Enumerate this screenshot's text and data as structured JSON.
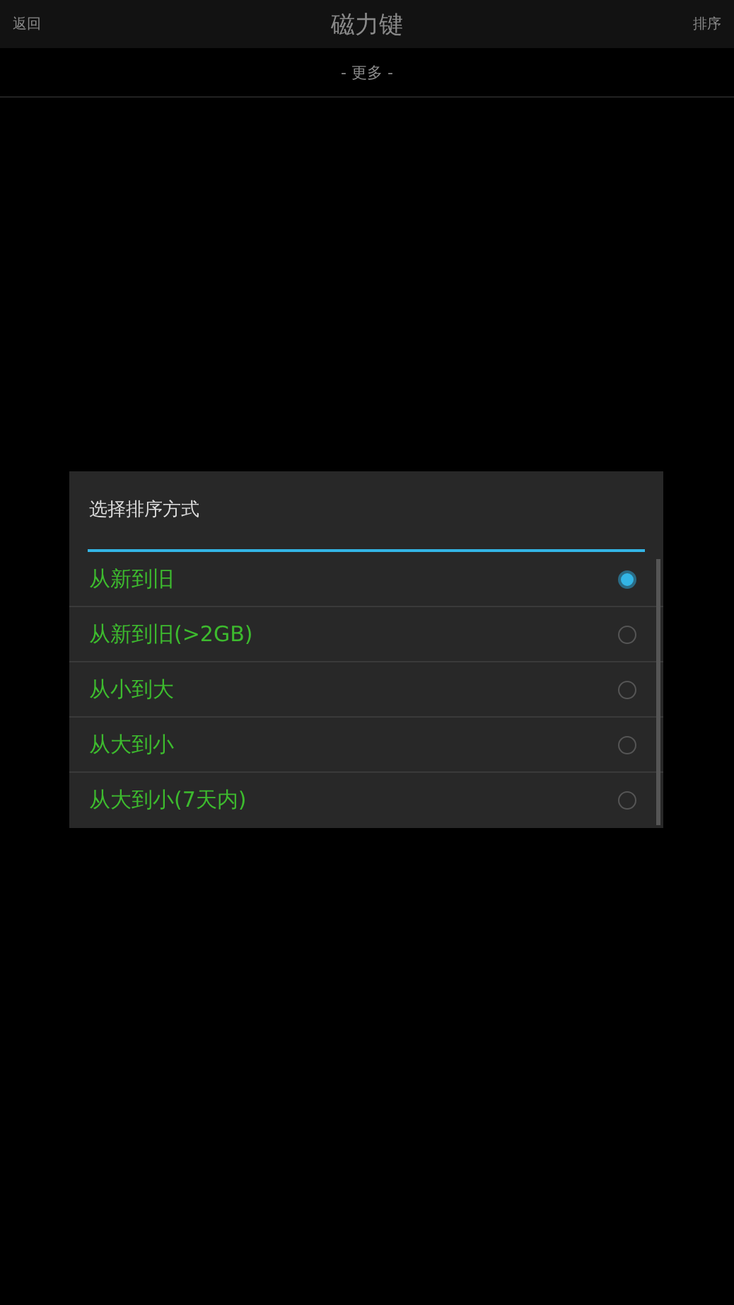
{
  "header": {
    "back": "返回",
    "title": "磁力键",
    "sort": "排序"
  },
  "more": "- 更多 -",
  "dialog": {
    "title": "选择排序方式",
    "options": [
      {
        "label": "从新到旧",
        "selected": true
      },
      {
        "label": "从新到旧(>2GB)",
        "selected": false
      },
      {
        "label": "从小到大",
        "selected": false
      },
      {
        "label": "从大到小",
        "selected": false
      },
      {
        "label": "从大到小(7天内)",
        "selected": false
      }
    ]
  }
}
